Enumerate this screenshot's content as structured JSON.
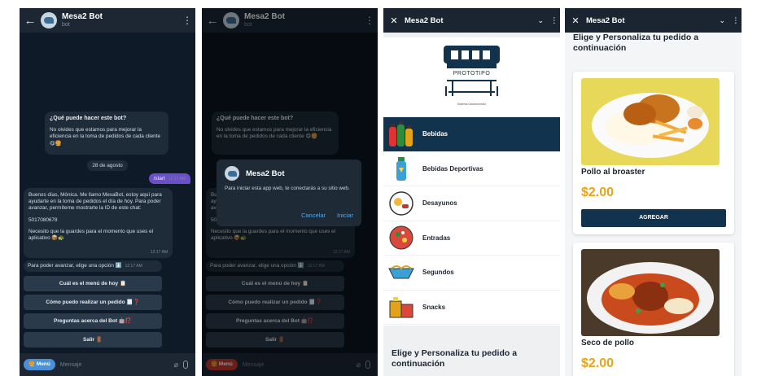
{
  "bot": {
    "name": "Mesa2 Bot",
    "subtitle": "bot"
  },
  "chat": {
    "intro_title": "¿Qué puede hacer este bot?",
    "intro_text": "No olvides que estamos para mejorar la eficiencia en la toma de pedidos de cada cliente 😋🍔",
    "date": "28 de agosto",
    "out_msg": "/start",
    "out_time": "12:17 AM",
    "greet_text": "Buenos días, Mónica. Me llamo MesaBot, estoy aquí para ayudarte en la toma de pedidos el día de hoy. Para poder avanzar, permíteme mostrarte la ID de este chat:",
    "chat_id": "5017080678",
    "save_text": "Necesito que la guardes para el momento que uses el aplicativo 📦🐢",
    "save_time": "12:17 AM",
    "options_text": "Para poder avanzar, elige una opción ⬇️",
    "options_time": "12:17 AM",
    "keyboard": [
      "Cuál es el menú de hoy 📋",
      "Cómo puedo realizar un pedido 🧾❓",
      "Preguntas acerca del Bot 🤖⁉️",
      "Salir 🚪"
    ],
    "menu_label": "🍔 Menú",
    "placeholder": "Mensaje"
  },
  "dialog": {
    "title": "Mesa2 Bot",
    "message": "Para iniciar esta app web, te conectarás a su sitio web.",
    "cancel": "Cancelar",
    "start": "Iniciar"
  },
  "webapp": {
    "title": "Mesa2 Bot",
    "logo_text": "PROTOTIPO",
    "logo_sub": "Sistema Gastronómico",
    "categories": [
      "Bebidas",
      "Bebidas Deportivas",
      "Desayunos",
      "Entradas",
      "Segundos",
      "Snacks"
    ],
    "section_title": "Elige y Personaliza tu pedido a continuación"
  },
  "products": [
    {
      "name": "Pollo al broaster",
      "price": "$2.00",
      "button": "AGREGAR"
    },
    {
      "name": "Seco de pollo",
      "price": "$2.00"
    }
  ],
  "colors": {
    "accent": "#12334d",
    "price": "#e8a317",
    "chat_bg": "#0f1a29",
    "out_bubble": "#6b4fc9"
  }
}
